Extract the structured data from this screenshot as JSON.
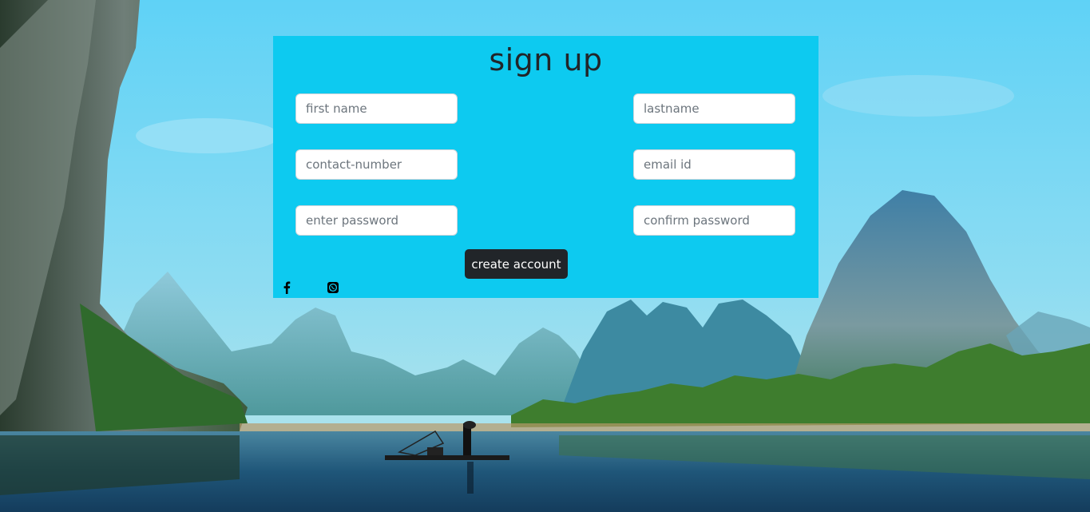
{
  "form": {
    "title": "sign up",
    "fields": {
      "first_name": {
        "placeholder": "first name",
        "value": ""
      },
      "last_name": {
        "placeholder": "lastname",
        "value": ""
      },
      "contact_number": {
        "placeholder": "contact-number",
        "value": ""
      },
      "email": {
        "placeholder": "email id",
        "value": ""
      },
      "password": {
        "placeholder": "enter password",
        "value": ""
      },
      "confirm_password": {
        "placeholder": "confirm password",
        "value": ""
      }
    },
    "submit_label": "create account"
  },
  "social": [
    {
      "icon": "facebook-icon"
    },
    {
      "icon": "whatsapp-icon"
    }
  ],
  "colors": {
    "card_bg": "#0dcaf0",
    "button_bg": "#212529",
    "title_text": "#212529"
  }
}
